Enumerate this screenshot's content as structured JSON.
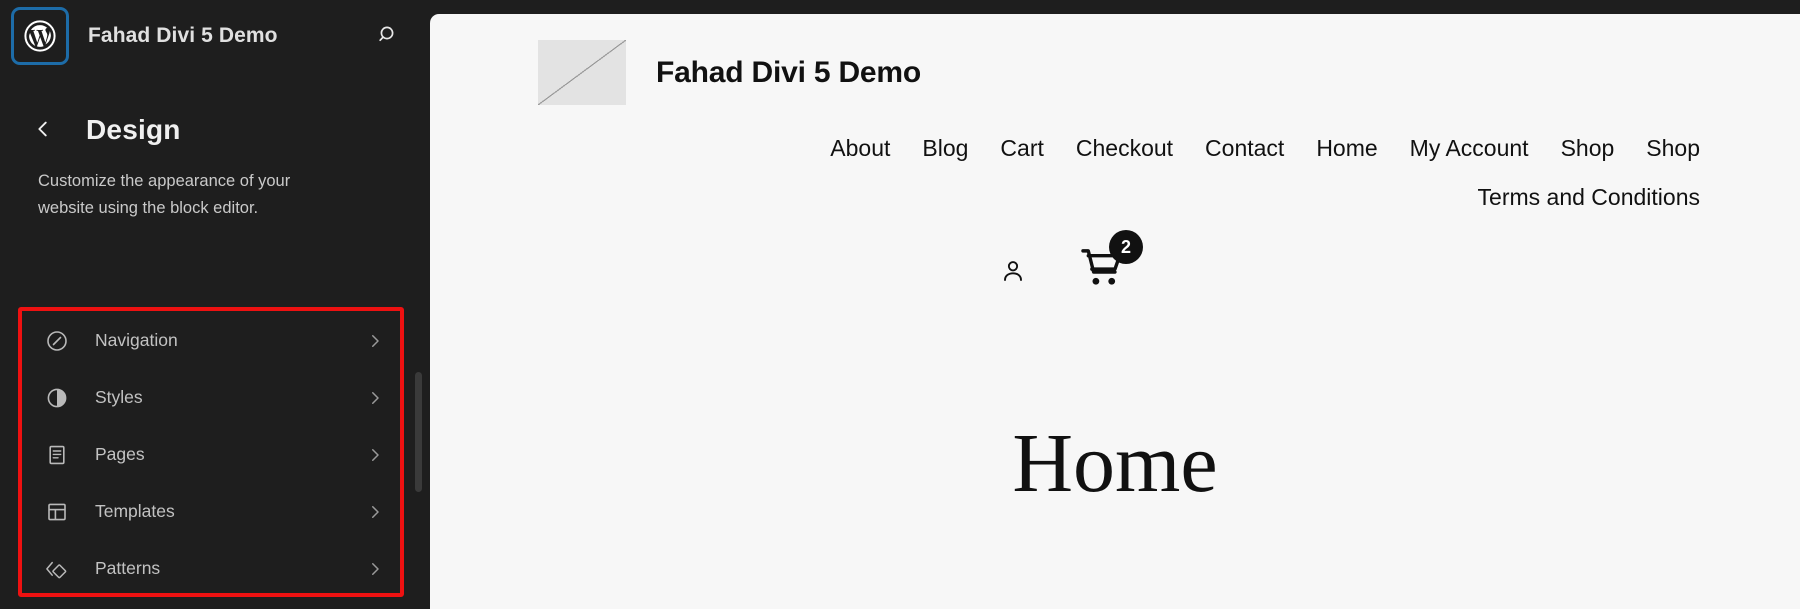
{
  "sidebar": {
    "logo_icon": "wordpress-logo-icon",
    "site_title": "Fahad Divi 5 Demo",
    "search_icon": "search-icon",
    "back_icon": "chevron-left-icon",
    "panel_title": "Design",
    "description": "Customize the appearance of your website using the block editor.",
    "menu_items": [
      {
        "label": "Navigation",
        "icon": "compass-icon",
        "chevron": "chevron-right-icon"
      },
      {
        "label": "Styles",
        "icon": "contrast-half-circle-icon",
        "chevron": "chevron-right-icon"
      },
      {
        "label": "Pages",
        "icon": "page-document-icon",
        "chevron": "chevron-right-icon"
      },
      {
        "label": "Templates",
        "icon": "layout-template-icon",
        "chevron": "chevron-right-icon"
      },
      {
        "label": "Patterns",
        "icon": "diamond-pattern-icon",
        "chevron": "chevron-right-icon"
      }
    ],
    "highlight_color": "#ee1111"
  },
  "preview": {
    "logo_placeholder_icon": "broken-image-placeholder-icon",
    "site_title": "Fahad Divi 5 Demo",
    "nav_links": [
      "About",
      "Blog",
      "Cart",
      "Checkout",
      "Contact",
      "Home",
      "My Account",
      "Shop",
      "Shop"
    ],
    "nav_links_row2": [
      "Terms and Conditions"
    ],
    "account_icon": "user-account-icon",
    "cart_icon": "shopping-cart-icon",
    "cart_count": "2",
    "page_heading": "Home"
  }
}
